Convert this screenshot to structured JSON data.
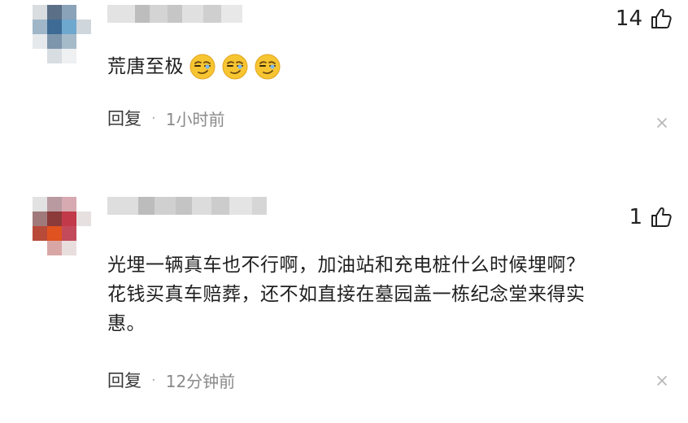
{
  "comments": [
    {
      "likes": "14",
      "text": "荒唐至极",
      "emojis": [
        "smirk-emoji",
        "smirk-emoji",
        "smirk-emoji"
      ],
      "reply_label": "回复",
      "separator": "·",
      "time": "1小时前"
    },
    {
      "likes": "1",
      "text_lines": [
        "光埋一辆真车也不行啊，加油站和充电桩什么时候埋啊？",
        "花钱买真车赔葬，还不如直接在墓园盖一栋纪念堂来得实",
        "惠。"
      ],
      "reply_label": "回复",
      "separator": "·",
      "time": "12分钟前"
    }
  ],
  "icons": {
    "like": "thumbs-up-icon",
    "close": "close-icon"
  },
  "colors": {
    "text": "#1f1f1f",
    "meta": "#8a8a8a",
    "emoji_face": "#f7c531"
  }
}
